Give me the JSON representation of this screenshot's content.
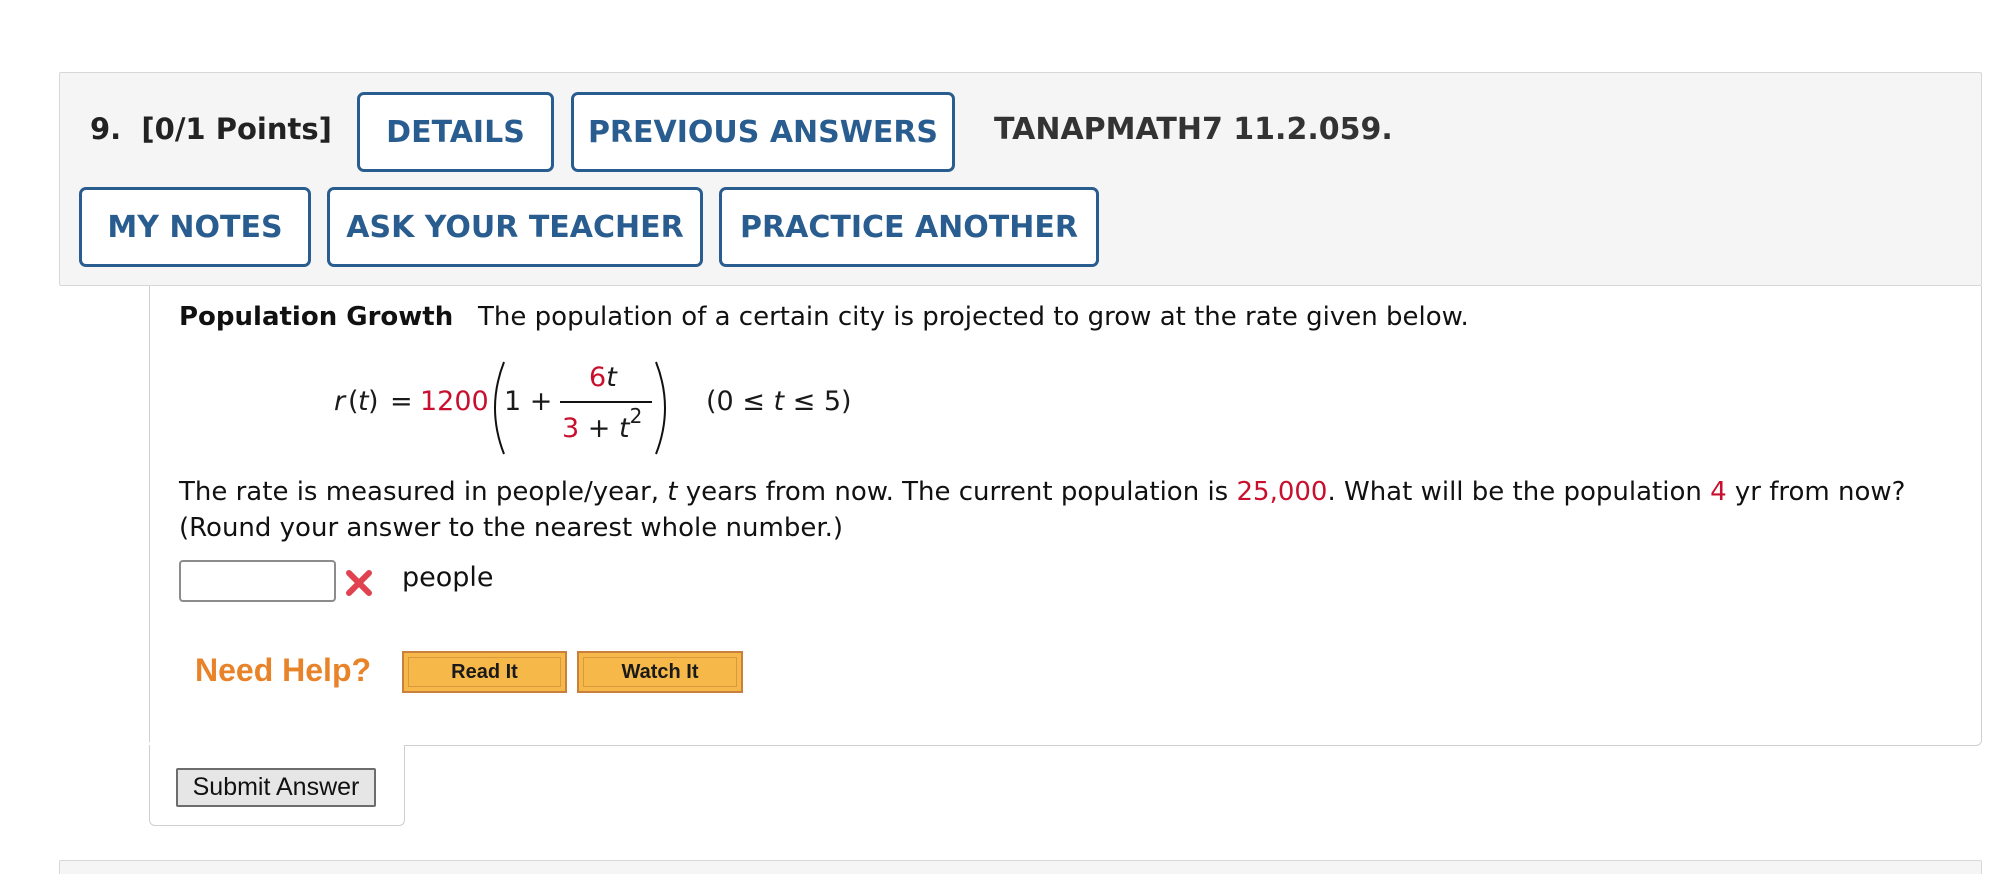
{
  "question": {
    "number_label": "9.",
    "points_label": "[0/1 Points]",
    "reference": "TANAPMATH7 11.2.059."
  },
  "header_buttons": {
    "details": "DETAILS",
    "previous_answers": "PREVIOUS ANSWERS",
    "my_notes": "MY NOTES",
    "ask_teacher": "ASK YOUR TEACHER",
    "practice_another": "PRACTICE ANOTHER"
  },
  "problem": {
    "title": "Population Growth",
    "intro": "The population of a certain city is projected to grow at the rate given below.",
    "formula": {
      "lhs_func": "r",
      "lhs_open": "(",
      "lhs_var": "t",
      "lhs_close": ")",
      "equals": "=",
      "coefficient": "1200",
      "one_plus": "1 +",
      "numerator_coef": "6",
      "numerator_var": "t",
      "denominator_const": "3",
      "denominator_plus": "+",
      "denominator_var": "t",
      "denominator_exp": "2",
      "domain_open": "(0 ≤ ",
      "domain_var": "t",
      "domain_close": " ≤ 5)"
    },
    "sentence_part1": "The rate is measured in people/year, ",
    "sentence_var": "t",
    "sentence_part2": " years from now. The current population is ",
    "current_population": "25,000",
    "sentence_part3": ". What will be the population ",
    "years": "4",
    "sentence_part4": " yr from now?",
    "round_note": "(Round your answer to the nearest whole number.)"
  },
  "answer": {
    "value": "",
    "unit": "people",
    "status": "incorrect",
    "status_icon": "x-mark-icon",
    "status_color": "#e0434f"
  },
  "help": {
    "label": "Need Help?",
    "read_it": "Read It",
    "watch_it": "Watch It"
  },
  "submit_label": "Submit Answer",
  "colors": {
    "accent_blue": "#2a5d8f",
    "highlight_red": "#c8102e",
    "help_orange": "#e8832a",
    "help_button": "#f7b84a"
  }
}
